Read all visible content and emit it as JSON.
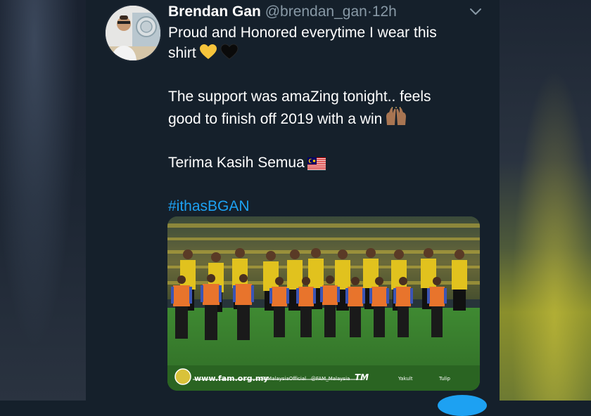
{
  "tweet": {
    "author_name": "Brendan Gan",
    "handle": "@brendan_gan",
    "separator": "·",
    "time": "12h",
    "lines": [
      "Proud and Honored everytime I wear this",
      "shirt",
      "The support was amaZing tonight.. feels",
      "good to finish off 2019 with a win",
      "Terima Kasih Semua",
      "#ithasBGAN"
    ],
    "media_banner": {
      "website": "www.fam.org.my",
      "facebook": "FAMalaysiaOfficial",
      "twitter": "@FAM_Malaysia",
      "sponsor": "TM",
      "sponsor2": "Yakult",
      "sponsor3": "Tulip"
    }
  },
  "icons": {
    "chevron": "chevron-down-icon",
    "hearts": [
      "yellow-heart-icon",
      "black-heart-icon"
    ],
    "raised_hands": "raised-hands-icon",
    "flag": "malaysia-flag-icon"
  },
  "colors": {
    "background": "#15202b",
    "secondary_text": "#8899a6",
    "link": "#1da1f2"
  }
}
